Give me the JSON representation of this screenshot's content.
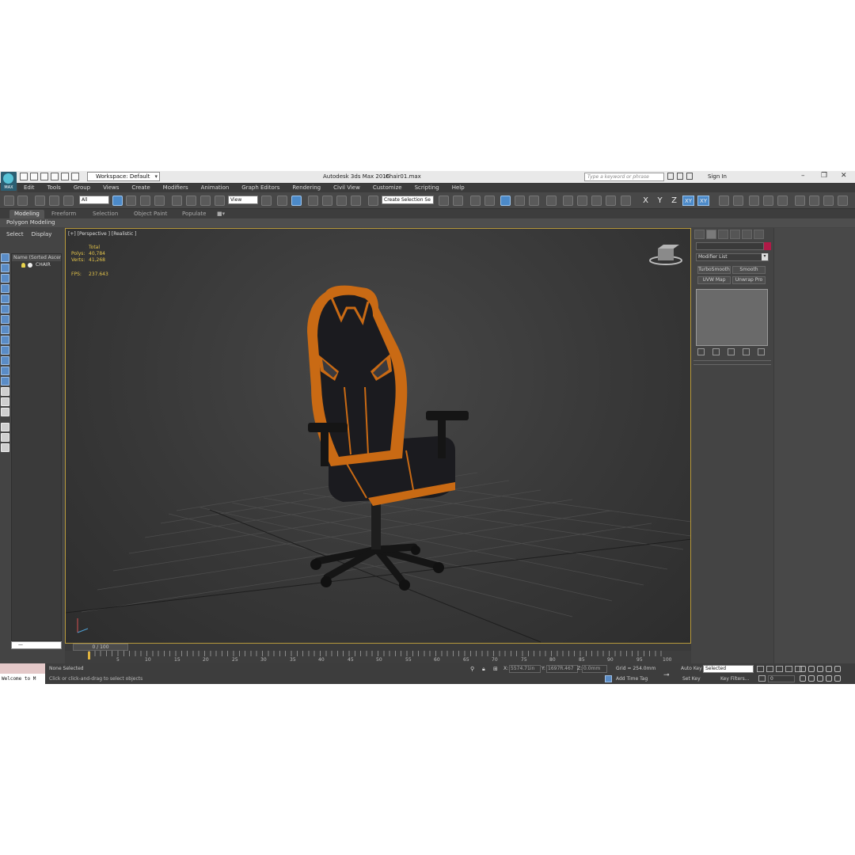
{
  "titlebar": {
    "logo": "MAX",
    "workspace": "Workspace: Default",
    "app_title": "Autodesk 3ds Max 2016",
    "file_name": "Chair01.max",
    "search_placeholder": "Type a keyword or phrase",
    "sign_in": "Sign In",
    "minimize": "–",
    "maximize": "❐",
    "close": "✕"
  },
  "menu": [
    "Edit",
    "Tools",
    "Group",
    "Views",
    "Create",
    "Modifiers",
    "Animation",
    "Graph Editors",
    "Rendering",
    "Civil View",
    "Customize",
    "Scripting",
    "Help"
  ],
  "toolbar": {
    "selection_filter": "All",
    "ref_coord": "View",
    "named_selection": "Create Selection Se",
    "axis_x": "X",
    "axis_y": "Y",
    "axis_z": "Z",
    "axis_xy": "XY",
    "axis_xy2": "XY"
  },
  "ribbon": {
    "tabs": [
      "Modeling",
      "Freeform",
      "Selection",
      "Object Paint",
      "Populate"
    ],
    "sub_label": "Polygon Modeling"
  },
  "scene_explorer": {
    "tab_select": "Select",
    "tab_display": "Display",
    "column_header": "Name (Sorted Ascending)",
    "items": [
      {
        "name": "CHAIR"
      }
    ],
    "bottom_field": "—"
  },
  "viewport": {
    "label": "[+] [Perspective ] [Realistic ]",
    "stats_header": "Total",
    "polys_label": "Polys:",
    "polys_value": "40,784",
    "verts_label": "Verts:",
    "verts_value": "41,268",
    "fps_label": "FPS:",
    "fps_value": "237.643",
    "colors": {
      "chair_black": "#1b1b1f",
      "chair_orange": "#c96a14",
      "grid": "#4a4a4a",
      "border": "#b89a3c"
    }
  },
  "command_panel": {
    "modifier_list": "Modifier List",
    "buttons": [
      "TurboSmooth",
      "Smooth",
      "UVW Map",
      "Unwrap Pro"
    ],
    "object_color": "#b01a47"
  },
  "timeline": {
    "slider": "0 / 100",
    "ticks": [
      "5",
      "10",
      "15",
      "20",
      "25",
      "30",
      "35",
      "40",
      "45",
      "50",
      "55",
      "60",
      "65",
      "70",
      "75",
      "80",
      "85",
      "90",
      "95",
      "100"
    ]
  },
  "status": {
    "maxscript": "Welcome to M",
    "selection": "None Selected",
    "prompt": "Click or click-and-drag to select objects",
    "x_label": "X:",
    "x_value": "5574.71in",
    "y_label": "Y:",
    "y_value": "1697R.467",
    "z_label": "Z:",
    "z_value": "0.0mm",
    "grid": "Grid = 254.0mm",
    "add_time_tag": "Add Time Tag",
    "auto_key": "Auto Key",
    "set_key": "Set Key",
    "selected_dropdown": "Selected",
    "key_filters": "Key Filters...",
    "frame": "0"
  }
}
